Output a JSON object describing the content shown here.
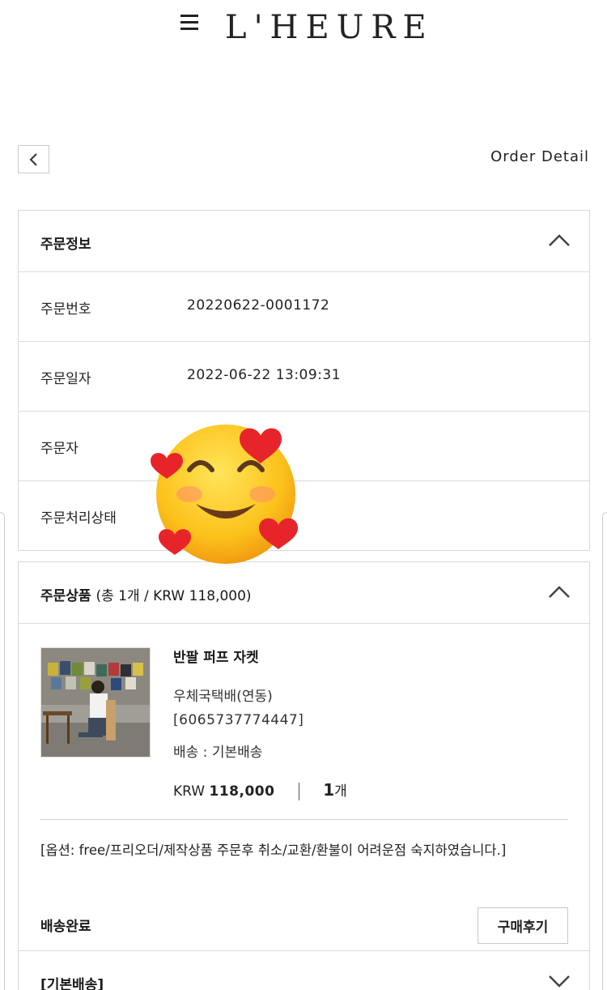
{
  "header": {
    "brand": "L'HEURE"
  },
  "page": {
    "title": "Order Detail"
  },
  "order_info": {
    "title": "주문정보",
    "rows": [
      {
        "label": "주문번호",
        "value": "20220622-0001172"
      },
      {
        "label": "주문일자",
        "value": "2022-06-22 13:09:31"
      },
      {
        "label": "주문자",
        "value": ""
      },
      {
        "label": "주문처리상태",
        "value": ""
      }
    ]
  },
  "order_items": {
    "title": "주문상품",
    "summary": "(총 1개 / KRW 118,000)",
    "product": {
      "name": "반팔 퍼프 자켓",
      "carrier": "우체국택배(연동)",
      "tracking": "[6065737774447]",
      "delivery": "배송 : 기본배송",
      "currency": "KRW",
      "price": "118,000",
      "qty_number": "1",
      "qty_unit": "개",
      "option_text": "[옵션: free/프리오더/제작상품 주문후 취소/교환/환불이 어려운점 숙지하였습니다.]",
      "status": "배송완료",
      "review_button": "구매후기"
    }
  },
  "shipping_section": {
    "title": "[기본배송]"
  },
  "icons": {
    "menu": "menu-icon",
    "back": "chevron-left-icon",
    "collapse": "chevron-up-icon",
    "expand": "chevron-down-icon",
    "sticker": "smiling-face-with-hearts-icon"
  }
}
